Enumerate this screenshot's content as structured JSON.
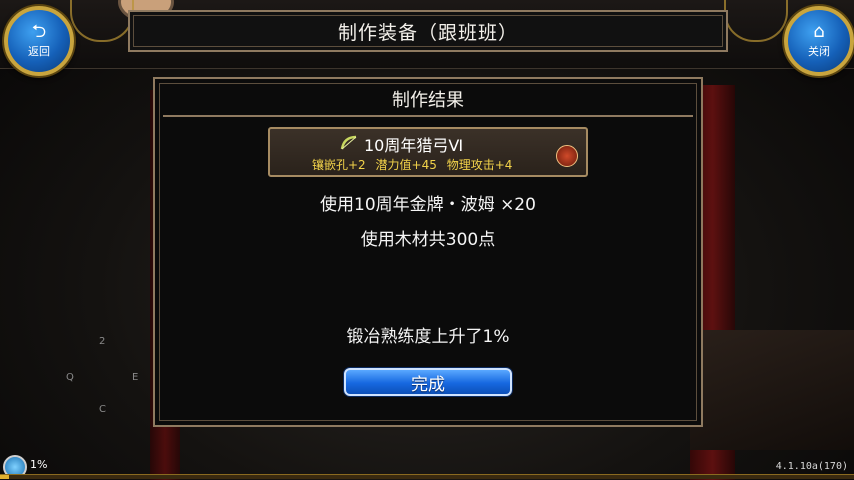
{
  "window": {
    "title": "制作装备（跟班班）"
  },
  "nav": {
    "back_label": "返回",
    "close_label": "关闭"
  },
  "result": {
    "header": "制作结果",
    "item": {
      "name": "10周年猎弓Ⅵ",
      "stats": [
        "镶嵌孔+2",
        "潜力值+45",
        "物理攻击+4"
      ],
      "name_color": "#ffffff",
      "stats_color": "#f2d34a"
    },
    "usage_line_1": "使用10周年金牌・波姆 ×20",
    "usage_line_2": "使用木材共300点",
    "proficiency_line": "锻冶熟练度上升了1%",
    "done_label": "完成"
  },
  "dpad": {
    "up": "2",
    "left": "Q",
    "right": "E",
    "down": "C"
  },
  "status": {
    "percent_text": "1%",
    "progress": 0.01,
    "version": "4.1.10a(170)"
  },
  "colors": {
    "accent_blue": "#1668e0",
    "frame_gold": "#8f7a60",
    "stat_yellow": "#f2d34a"
  }
}
